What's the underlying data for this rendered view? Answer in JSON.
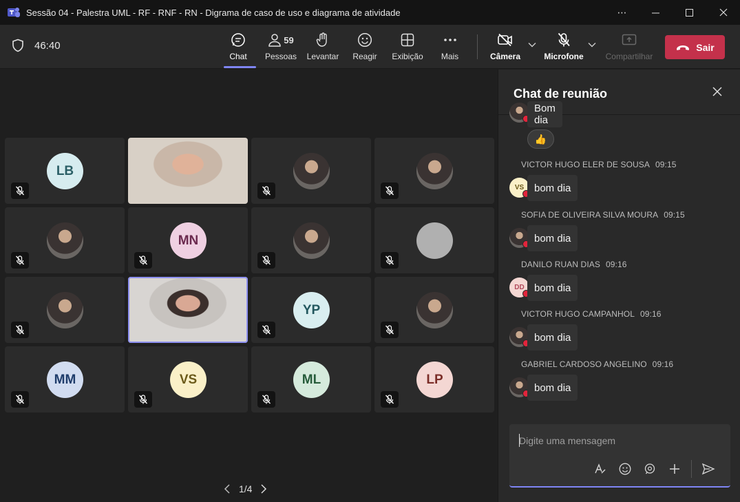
{
  "window": {
    "title": "Sessão 04 - Palestra UML - RF - RNF - RN - Digrama de caso de uso e diagrama de atividade"
  },
  "toolbar": {
    "timer": "46:40",
    "buttons": {
      "chat": "Chat",
      "people": "Pessoas",
      "people_count": "59",
      "raise": "Levantar",
      "react": "Reagir",
      "view": "Exibição",
      "more": "Mais",
      "camera": "Câmera",
      "mic": "Microfone",
      "share": "Compartilhar",
      "leave": "Sair"
    }
  },
  "stage": {
    "tiles": [
      {
        "initials": "LB",
        "bg": "#d6ecef",
        "fg": "#2b5f66",
        "type": "initials"
      },
      {
        "initials": "",
        "type": "video"
      },
      {
        "initials": "",
        "type": "photo"
      },
      {
        "initials": "",
        "type": "photo"
      },
      {
        "initials": "",
        "type": "photo"
      },
      {
        "initials": "MN",
        "bg": "#efd0e2",
        "fg": "#6b2a4f",
        "type": "initials"
      },
      {
        "initials": "",
        "type": "photo"
      },
      {
        "initials": "",
        "bg": "#b0b0b0",
        "type": "blank"
      },
      {
        "initials": "",
        "type": "photo"
      },
      {
        "initials": "",
        "type": "video-speaking"
      },
      {
        "initials": "YP",
        "bg": "#d9eef0",
        "fg": "#23585f",
        "type": "initials"
      },
      {
        "initials": "",
        "type": "photo"
      },
      {
        "initials": "MM",
        "bg": "#d1dcf0",
        "fg": "#1f3d6b",
        "type": "initials"
      },
      {
        "initials": "VS",
        "bg": "#faf0c8",
        "fg": "#6b5a1a",
        "type": "initials"
      },
      {
        "initials": "ML",
        "bg": "#d5eadc",
        "fg": "#275c3b",
        "type": "initials"
      },
      {
        "initials": "LP",
        "bg": "#f4d7d3",
        "fg": "#7b2e28",
        "type": "initials"
      }
    ],
    "pager": "1/4"
  },
  "chat": {
    "title": "Chat de reunião",
    "top_message": "Bom dia",
    "reaction": "👍",
    "messages": [
      {
        "sender": "VICTOR HUGO ELER DE SOUSA",
        "time": "09:15",
        "text": "bom dia",
        "initials": "VS",
        "bg": "#faf0c8",
        "fg": "#6b5a1a"
      },
      {
        "sender": "SOFIA DE OLIVEIRA SILVA MOURA",
        "time": "09:15",
        "text": "bom dia",
        "initials": "",
        "bg": "#9a8a8c",
        "fg": "#fff"
      },
      {
        "sender": "DANILO RUAN DIAS",
        "time": "09:16",
        "text": "bom dia",
        "initials": "DD",
        "bg": "#f4d7d3",
        "fg": "#b24a5c"
      },
      {
        "sender": "VICTOR HUGO CAMPANHOL",
        "time": "09:16",
        "text": "bom dia",
        "initials": "",
        "bg": "#6b6260",
        "fg": "#fff"
      },
      {
        "sender": "GABRIEL CARDOSO ANGELINO",
        "time": "09:16",
        "text": "bom dia",
        "initials": "",
        "bg": "#7a7370",
        "fg": "#fff"
      }
    ],
    "composer_placeholder": "Digite uma mensagem"
  }
}
